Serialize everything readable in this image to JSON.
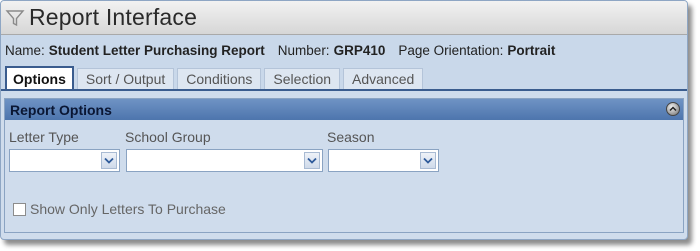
{
  "window": {
    "title": "Report Interface",
    "title_icon": "funnel-icon"
  },
  "info": {
    "name_label": "Name:",
    "name_value": "Student Letter Purchasing Report",
    "number_label": "Number:",
    "number_value": "GRP410",
    "orientation_label": "Page Orientation:",
    "orientation_value": "Portrait"
  },
  "tabs": [
    {
      "label": "Options",
      "active": true
    },
    {
      "label": "Sort / Output",
      "active": false
    },
    {
      "label": "Conditions",
      "active": false
    },
    {
      "label": "Selection",
      "active": false
    },
    {
      "label": "Advanced",
      "active": false
    }
  ],
  "panel": {
    "title": "Report Options",
    "collapse_icon": "collapse-icon",
    "fields": [
      {
        "label": "Letter Type",
        "value": ""
      },
      {
        "label": "School Group",
        "value": ""
      },
      {
        "label": "Season",
        "value": ""
      }
    ],
    "checkbox": {
      "label": "Show Only Letters To Purchase",
      "checked": false
    }
  },
  "colors": {
    "panel_bg": "#cfdcec",
    "header_blue": "#4d75ad",
    "tab_border": "#3a5c8e"
  }
}
